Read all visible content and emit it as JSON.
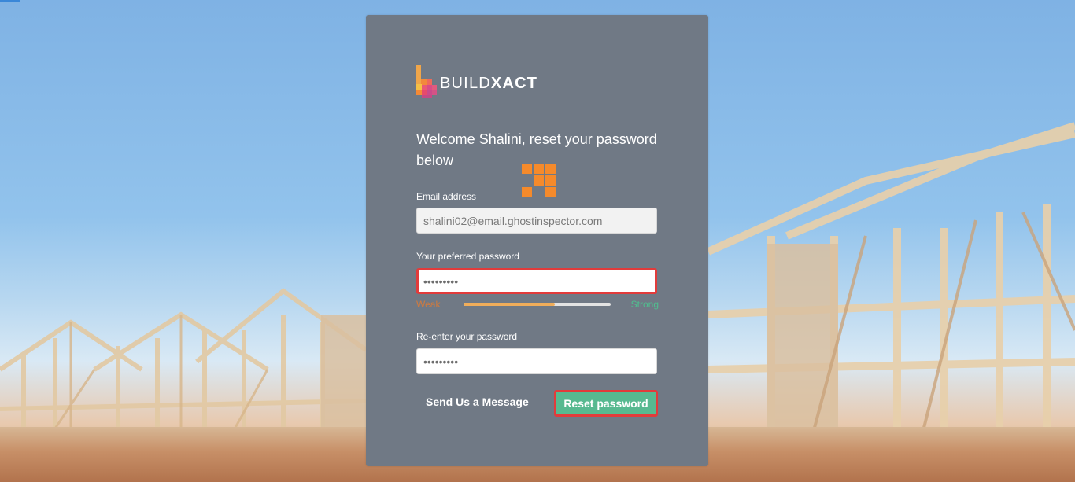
{
  "brand": {
    "name_light": "BUILD",
    "name_bold": "XACT"
  },
  "form": {
    "heading": "Welcome Shalini, reset your password below",
    "email": {
      "label": "Email address",
      "value": "shalini02@email.ghostinspector.com"
    },
    "password": {
      "label": "Your preferred password",
      "value": "•••••••••"
    },
    "strength": {
      "weak_label": "Weak",
      "strong_label": "Strong",
      "level": 0.62
    },
    "confirm": {
      "label": "Re-enter your password",
      "value": "•••••••••"
    },
    "send_message_label": "Send Us a Message",
    "submit_label": "Reset password"
  },
  "colors": {
    "card": "#707985",
    "accent_green": "#57b990",
    "error_border": "#e23b3b",
    "loader": "#f58a2b",
    "weak": "#d07a3e",
    "strong": "#4fbf8f"
  },
  "icons": {
    "logo": "buildxact-logo-icon",
    "loader": "loading-spinner-icon"
  }
}
